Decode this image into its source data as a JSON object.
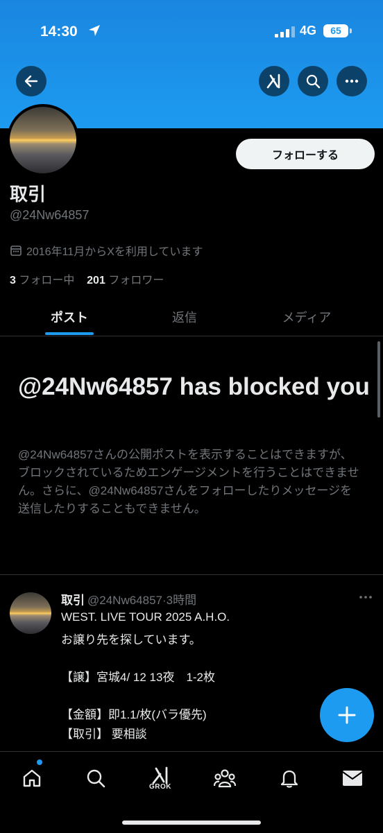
{
  "status_bar": {
    "time": "14:30",
    "network": "4G",
    "battery": "65"
  },
  "header": {
    "back_icon": "back-arrow-icon",
    "grok_icon": "grok-icon",
    "search_icon": "search-icon",
    "more_icon": "more-icon"
  },
  "profile": {
    "follow_button": "フォローする",
    "display_name": "取引",
    "handle": "@24Nw64857",
    "joined": "2016年11月からXを利用しています",
    "following_count": "3",
    "following_label": "フォロー中",
    "followers_count": "201",
    "followers_label": "フォロワー"
  },
  "tabs": [
    "ポスト",
    "返信",
    "メディア"
  ],
  "blocked": {
    "title": "@24Nw64857 has blocked you",
    "description": "@24Nw64857さんの公開ポストを表示することはできますが、ブロックされているためエンゲージメントを行うことはできません。さらに、@24Nw64857さんをフォローしたりメッセージを送信したりすることもできません。"
  },
  "post": {
    "name": "取引",
    "handle": "@24Nw64857",
    "time": "·3時間",
    "lines": [
      "WEST. LIVE TOUR 2025 A.H.O.",
      "お譲り先を探しています。",
      "【譲】宮城4/ 12 13夜　1-2枚",
      "【金額】即1.1/枚(バラ優先)",
      "【取引】 要相談"
    ]
  },
  "bottom_nav": {
    "grok_label": "GROK"
  },
  "colors": {
    "accent": "#1d9bf0",
    "background": "#000000",
    "text_primary": "#e7e9ea",
    "text_secondary": "#71767b"
  }
}
